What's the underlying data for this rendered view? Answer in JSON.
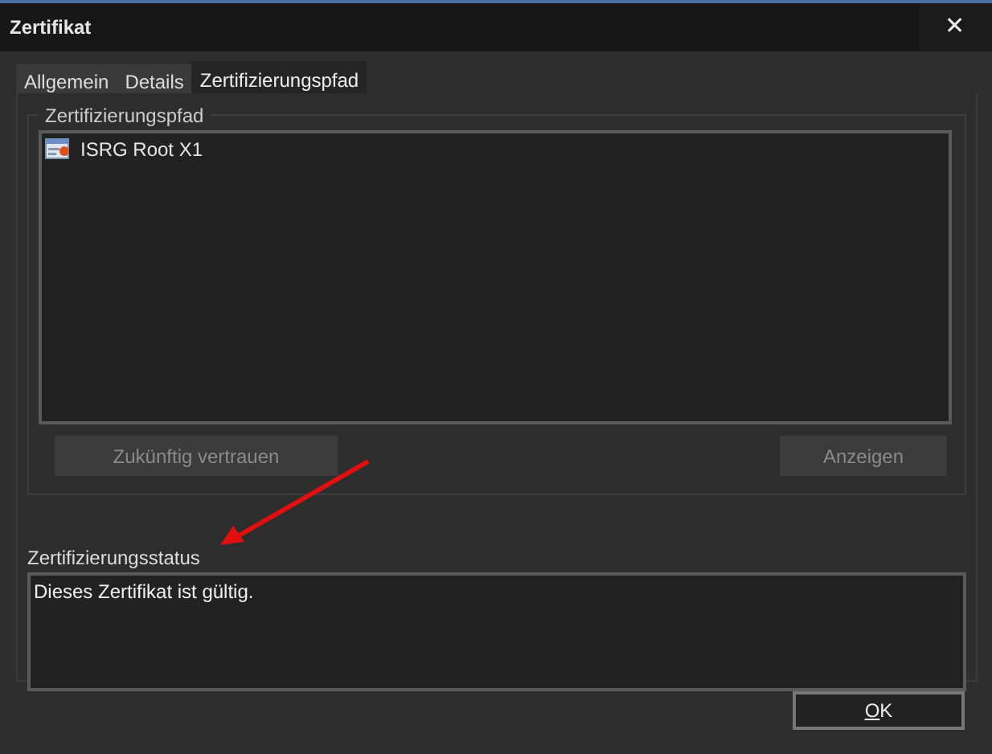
{
  "window": {
    "title": "Zertifikat",
    "close": "✕"
  },
  "tabs": [
    {
      "label": "Allgemein",
      "selected": false
    },
    {
      "label": "Details",
      "selected": false
    },
    {
      "label": "Zertifizierungspfad",
      "selected": true
    }
  ],
  "path_group": {
    "title": "Zertifizierungspfad",
    "items": [
      {
        "label": "ISRG Root X1"
      }
    ],
    "buttons": [
      {
        "label": "Zukünftig vertrauen",
        "disabled": true
      },
      {
        "label": "Anzeigen",
        "disabled": true
      }
    ]
  },
  "status": {
    "label": "Zertifizierungsstatus",
    "value": "Dieses Zertifikat ist gültig."
  },
  "footer_buttons": [
    {
      "label": "OK"
    }
  ]
}
